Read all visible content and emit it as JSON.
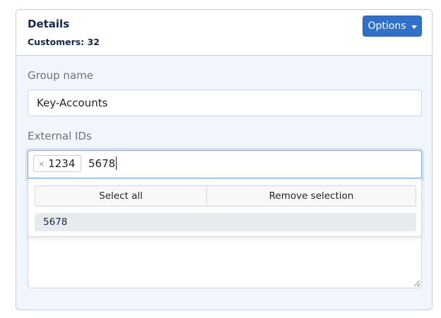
{
  "card": {
    "title": "Details",
    "subtitle": "Customers: 32",
    "options_label": "Options"
  },
  "group_name": {
    "label": "Group name",
    "value": "Key-Accounts"
  },
  "external_ids": {
    "label": "External IDs",
    "tags": [
      "1234"
    ],
    "tag_remove_glyph": "×",
    "typed_value": "5678",
    "dropdown": {
      "select_all_label": "Select all",
      "remove_selection_label": "Remove selection",
      "options": [
        "5678"
      ]
    }
  },
  "colors": {
    "accent": "#2f70c8",
    "title": "#13294b",
    "card_bg": "#f1f6fc"
  }
}
